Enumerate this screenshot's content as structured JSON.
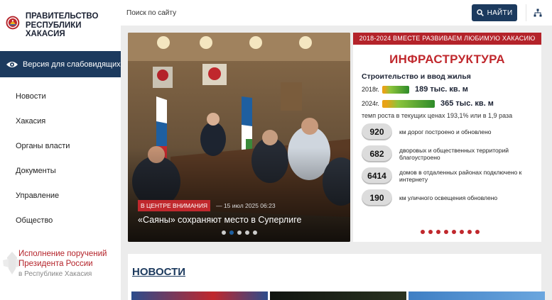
{
  "site": {
    "title": "Правительство Республики Хакасия"
  },
  "search": {
    "placeholder": "Поиск по сайту",
    "button_label": "НАЙТИ"
  },
  "accessibility": {
    "label": "Версия для слабовидящих"
  },
  "menu": {
    "items": [
      {
        "label": "Новости"
      },
      {
        "label": "Хакасия"
      },
      {
        "label": "Органы власти"
      },
      {
        "label": "Документы"
      },
      {
        "label": "Управление"
      },
      {
        "label": "Общество"
      }
    ]
  },
  "president": {
    "title": "Исполнение поручений Президента России",
    "subtitle": "в Республике Хакасия"
  },
  "slider": {
    "badge": "В ЦЕНТРЕ ВНИМАНИЯ",
    "date": "15 июл 2025 06:23",
    "title": "«Саяны» сохраняют место в Суперлиге",
    "dot_count": 5,
    "active_dot": 1
  },
  "infra": {
    "banner": "2018-2024 ВМЕСТЕ РАЗВИВАЕМ ЛЮБИМУЮ ХАКАСИЮ",
    "title": "ИНФРАСТРУКТУРА",
    "subtitle": "Строительство и ввод жилья",
    "metrics": [
      {
        "year": "2018г.",
        "value": "189 тыс. кв. м",
        "fraction": 0.52
      },
      {
        "year": "2024г.",
        "value": "365 тыс. кв. м",
        "fraction": 1.0
      }
    ],
    "growth": "темп роста в текущих ценах 193,1% или в 1,9 раза",
    "stats": [
      {
        "number": "920",
        "text": "км дорог построено и обновлено"
      },
      {
        "number": "682",
        "text": "дворовых и общественных территорий благоустроено"
      },
      {
        "number": "6414",
        "text": "домов в отдаленных районах подключено к интернету"
      },
      {
        "number": "190",
        "text": "км уличного освещения обновлено"
      }
    ],
    "dot_count": 8
  },
  "news": {
    "heading": "НОВОСТИ"
  },
  "colors": {
    "navy": "#1c3a5e",
    "red": "#b4232a",
    "green": "#2e8b2a",
    "orange": "#e8a317"
  }
}
